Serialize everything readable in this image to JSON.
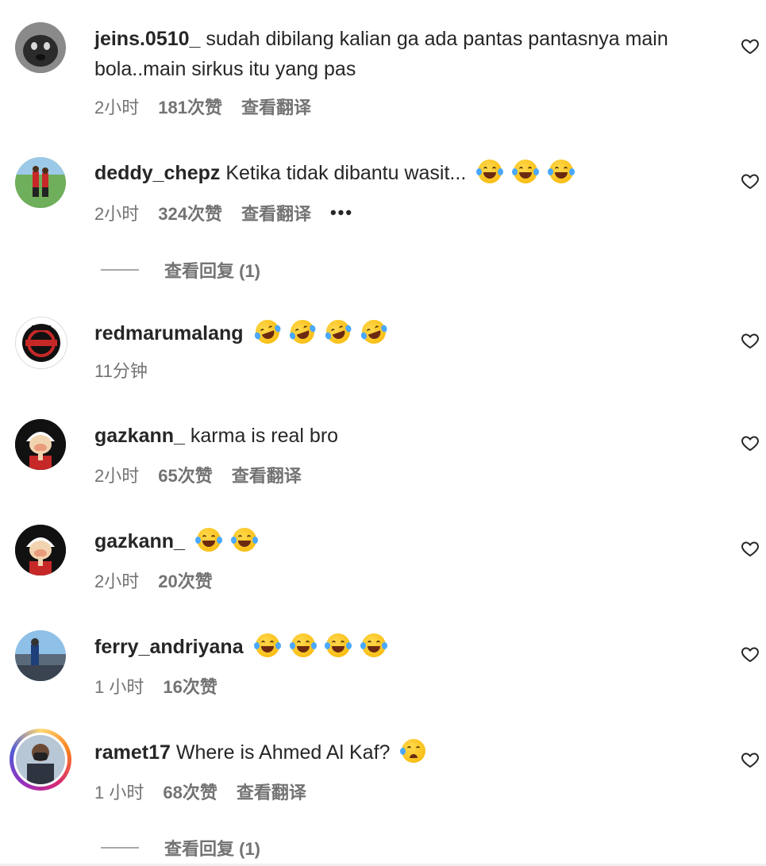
{
  "comments": [
    {
      "username": "jeins.0510_",
      "text": "sudah dibilang kalian ga ada pantas pantasnya main bola..main sirkus itu yang pas",
      "time": "2小时",
      "likes": "181次赞",
      "translate": "查看翻译",
      "avatar_icon": "dog-avatar"
    },
    {
      "username": "deddy_chepz",
      "text": "Ketika tidak dibantu wasit...",
      "emoji": [
        "joy",
        "joy",
        "joy"
      ],
      "time": "2小时",
      "likes": "324次赞",
      "translate": "查看翻译",
      "more": "•••",
      "replies": "查看回复 (1)",
      "avatar_icon": "football-field-avatar"
    },
    {
      "username": "redmarumalang",
      "text": "",
      "emoji": [
        "rofl",
        "rofl",
        "rofl",
        "rofl"
      ],
      "time": "11分钟",
      "avatar_icon": "club-logo-avatar"
    },
    {
      "username": "gazkann_",
      "text": "karma is real bro",
      "time": "2小时",
      "likes": "65次赞",
      "translate": "查看翻译",
      "avatar_icon": "popeye-avatar"
    },
    {
      "username": "gazkann_",
      "text": "",
      "emoji": [
        "joy",
        "joy"
      ],
      "time": "2小时",
      "likes": "20次赞",
      "avatar_icon": "popeye-avatar"
    },
    {
      "username": "ferry_andriyana",
      "text": "",
      "emoji": [
        "joy",
        "joy",
        "joy",
        "joy"
      ],
      "time": "1 小时",
      "likes": "16次赞",
      "avatar_icon": "outdoor-photo-avatar"
    },
    {
      "username": "ramet17",
      "text": "Where is Ahmed Al Kaf?",
      "emoji": [
        "sad-tear"
      ],
      "time": "1 小时",
      "likes": "68次赞",
      "translate": "查看翻译",
      "replies": "查看回复 (1)",
      "avatar_icon": "person-mask-avatar-story-ring"
    }
  ],
  "icons": {
    "like": "heart-outline-icon"
  },
  "colors": {
    "text": "#262626",
    "muted": "#737373",
    "emoji_yellow": "#f7b500"
  }
}
